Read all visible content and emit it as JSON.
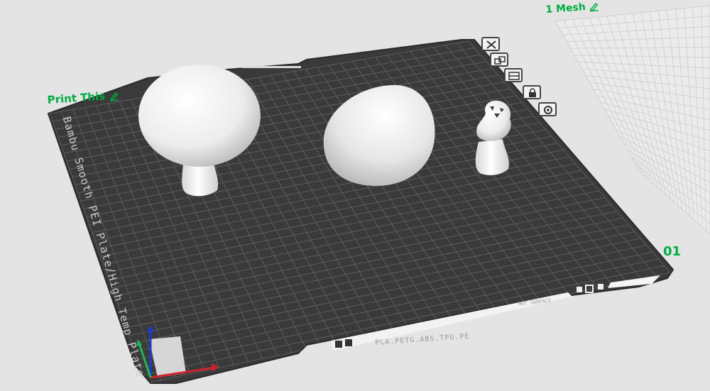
{
  "plate": {
    "name": "Print This",
    "number": "01",
    "bed_type": "Bambu Smooth PEI Plate/High Temp Plate",
    "filament_types": "PLA.PETG.ABS.TPU.PE",
    "side_text": "HOT SURFACE"
  },
  "mesh_panel": {
    "label": "1 Mesh"
  },
  "plate_toolbar": [
    {
      "name": "delete-plate-icon"
    },
    {
      "name": "arrange-icon"
    },
    {
      "name": "orient-icon"
    },
    {
      "name": "lock-icon"
    },
    {
      "name": "plate-settings-icon"
    }
  ],
  "objects": [
    {
      "name": "mushroom-large"
    },
    {
      "name": "mushroom-cap"
    },
    {
      "name": "mushroom-small"
    }
  ],
  "colors": {
    "accent": "#00ae42",
    "bed": "#3a3a3a",
    "grid": "#5c5c5c",
    "background": "#e4e4e4",
    "axis_x": "#d0222b",
    "axis_y": "#1fb55a",
    "axis_z": "#1e3cc8"
  }
}
